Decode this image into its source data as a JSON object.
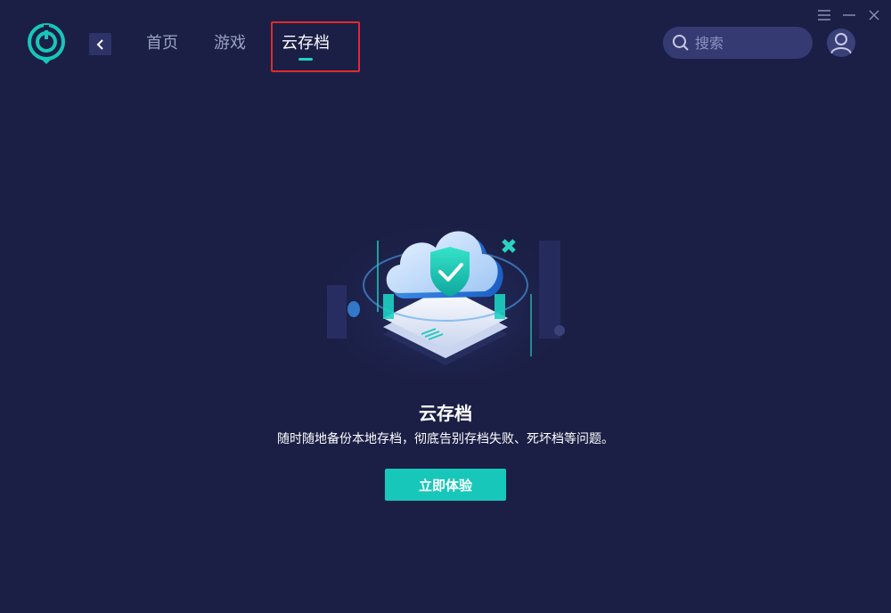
{
  "window": {
    "menu_icon": "menu-icon",
    "minimize_icon": "minimize-icon",
    "close_icon": "close-icon"
  },
  "header": {
    "logo_icon": "app-logo-icon",
    "back_icon": "chevron-left-icon",
    "nav": [
      {
        "label": "首页",
        "active": false
      },
      {
        "label": "游戏",
        "active": false
      },
      {
        "label": "云存档",
        "active": true
      }
    ],
    "search": {
      "placeholder": "搜索",
      "icon": "search-icon"
    },
    "avatar_icon": "user-icon"
  },
  "main": {
    "title": "云存档",
    "subtitle": "随时随地备份本地存档，彻底告别存档失败、死坏档等问题。",
    "cta_label": "立即体验",
    "illustration_icon": "cloud-check-icon"
  },
  "colors": {
    "background": "#1b1f45",
    "accent": "#17c7b9",
    "highlight": "#e02b2b",
    "nav_inactive": "#9aa0c4"
  }
}
